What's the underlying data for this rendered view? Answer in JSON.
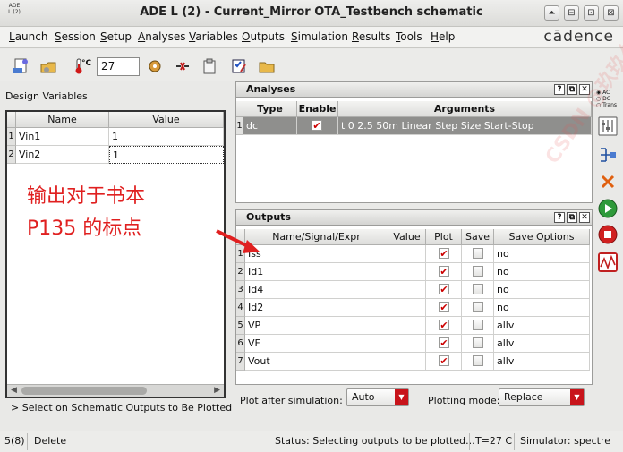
{
  "window": {
    "app_icon_text": "ADE L (2)",
    "title": "ADE L (2) - Current_Mirror OTA_Testbench schematic",
    "controls": [
      "⏶",
      "⊟",
      "⊡",
      "⊠"
    ]
  },
  "menu": {
    "items": [
      "Launch",
      "Session",
      "Setup",
      "Analyses",
      "Variables",
      "Outputs",
      "Simulation",
      "Results",
      "Tools",
      "Help"
    ],
    "brand": "cādence"
  },
  "toolbar": {
    "temp_unit": "°C",
    "temperature": "27"
  },
  "design_variables": {
    "label": "Design Variables",
    "headers": [
      "Name",
      "Value"
    ],
    "rows": [
      {
        "num": "1",
        "name": "Vin1",
        "value": "1"
      },
      {
        "num": "2",
        "name": "Vin2",
        "value": "1"
      }
    ]
  },
  "analyses": {
    "title": "Analyses",
    "headers": [
      "Type",
      "Enable",
      "Arguments"
    ],
    "rows": [
      {
        "num": "1",
        "type": "dc",
        "enabled": true,
        "arguments": "t 0 2.5 50m Linear Step Size Start-Stop"
      }
    ]
  },
  "outputs": {
    "title": "Outputs",
    "headers": [
      "Name/Signal/Expr",
      "Value",
      "Plot",
      "Save",
      "Save Options"
    ],
    "rows": [
      {
        "num": "1",
        "name": "Iss",
        "plot": true,
        "save": false,
        "save_option": "no"
      },
      {
        "num": "2",
        "name": "Id1",
        "plot": true,
        "save": false,
        "save_option": "no"
      },
      {
        "num": "3",
        "name": "Id4",
        "plot": true,
        "save": false,
        "save_option": "no"
      },
      {
        "num": "4",
        "name": "Id2",
        "plot": true,
        "save": false,
        "save_option": "no"
      },
      {
        "num": "5",
        "name": "VP",
        "plot": true,
        "save": false,
        "save_option": "allv"
      },
      {
        "num": "6",
        "name": "VF",
        "plot": true,
        "save": false,
        "save_option": "allv"
      },
      {
        "num": "7",
        "name": "Vout",
        "plot": true,
        "save": false,
        "save_option": "allv"
      }
    ],
    "plot_after_label": "Plot after simulation:",
    "plot_after_value": "Auto",
    "plotting_mode_label": "Plotting mode:",
    "plotting_mode_value": "Replace"
  },
  "right_bar": {
    "radio_labels": [
      "AC",
      "DC",
      "Trans"
    ]
  },
  "hint": "> Select on Schematic Outputs to Be Plotted",
  "status": {
    "count": "5(8)",
    "action": "Delete",
    "message": "Status: Selecting outputs to be plotted...",
    "temp": "T=27 C",
    "simulator": "Simulator: spectre"
  },
  "annotation": {
    "line1": "输出对于书本",
    "line2": "P135 的标点"
  },
  "watermark": "CSDN @玖玖久",
  "colors": {
    "check_red": "#d0141b",
    "arrow_red": "#e02020",
    "highlight_row": "#8f8f8d"
  }
}
